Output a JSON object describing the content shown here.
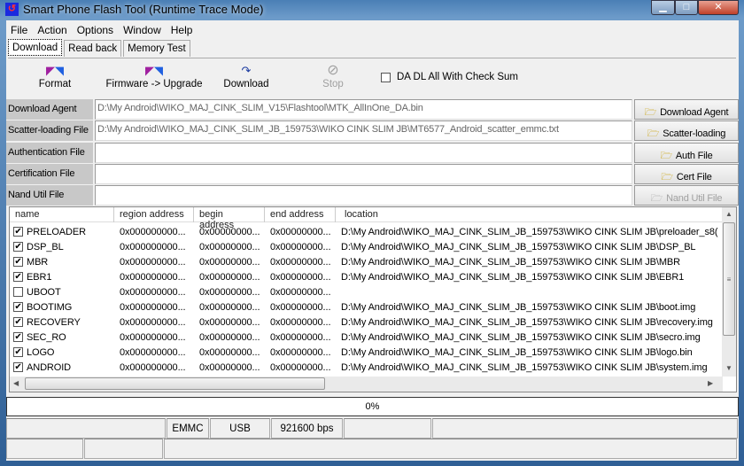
{
  "window": {
    "title": "Smart Phone Flash Tool (Runtime Trace Mode)",
    "controls": [
      "minimize",
      "maximize",
      "close"
    ]
  },
  "menu": [
    "File",
    "Action",
    "Options",
    "Window",
    "Help"
  ],
  "tabs": [
    {
      "label": "Download",
      "active": true
    },
    {
      "label": "Read back"
    },
    {
      "label": "Memory Test"
    }
  ],
  "toolbar": {
    "format": "Format",
    "firmware_upgrade": "Firmware -> Upgrade",
    "download": "Download",
    "stop": "Stop",
    "checksum_label": "DA DL All With Check Sum",
    "checksum_checked": false
  },
  "files": [
    {
      "label": "Download Agent",
      "value": "D:\\My Android\\WIKO_MAJ_CINK_SLIM_V15\\Flashtool\\MTK_AllInOne_DA.bin",
      "button": "Download Agent",
      "enabled": true
    },
    {
      "label": "Scatter-loading File",
      "value": "D:\\My Android\\WIKO_MAJ_CINK_SLIM_JB_159753\\WIKO CINK SLIM JB\\MT6577_Android_scatter_emmc.txt",
      "button": "Scatter-loading",
      "enabled": true
    },
    {
      "label": "Authentication File",
      "value": "",
      "button": "Auth File",
      "enabled": true
    },
    {
      "label": "Certification File",
      "value": "",
      "button": "Cert File",
      "enabled": true
    },
    {
      "label": "Nand Util File",
      "value": "",
      "button": "Nand Util File",
      "enabled": false
    }
  ],
  "table": {
    "columns": [
      "name",
      "region address",
      "begin address",
      "end address",
      "location"
    ],
    "rows": [
      {
        "checked": true,
        "name": "PRELOADER",
        "region": "0x000000000...",
        "begin": "0x00000000...",
        "end": "0x00000000...",
        "location": "D:\\My Android\\WIKO_MAJ_CINK_SLIM_JB_159753\\WIKO CINK SLIM JB\\preloader_s8("
      },
      {
        "checked": true,
        "name": "DSP_BL",
        "region": "0x000000000...",
        "begin": "0x00000000...",
        "end": "0x00000000...",
        "location": "D:\\My Android\\WIKO_MAJ_CINK_SLIM_JB_159753\\WIKO CINK SLIM JB\\DSP_BL"
      },
      {
        "checked": true,
        "name": "MBR",
        "region": "0x000000000...",
        "begin": "0x00000000...",
        "end": "0x00000000...",
        "location": "D:\\My Android\\WIKO_MAJ_CINK_SLIM_JB_159753\\WIKO CINK SLIM JB\\MBR"
      },
      {
        "checked": true,
        "name": "EBR1",
        "region": "0x000000000...",
        "begin": "0x00000000...",
        "end": "0x00000000...",
        "location": "D:\\My Android\\WIKO_MAJ_CINK_SLIM_JB_159753\\WIKO CINK SLIM JB\\EBR1"
      },
      {
        "checked": false,
        "name": "UBOOT",
        "region": "0x000000000...",
        "begin": "0x00000000...",
        "end": "0x00000000...",
        "location": ""
      },
      {
        "checked": true,
        "name": "BOOTIMG",
        "region": "0x000000000...",
        "begin": "0x00000000...",
        "end": "0x00000000...",
        "location": "D:\\My Android\\WIKO_MAJ_CINK_SLIM_JB_159753\\WIKO CINK SLIM JB\\boot.img"
      },
      {
        "checked": true,
        "name": "RECOVERY",
        "region": "0x000000000...",
        "begin": "0x00000000...",
        "end": "0x00000000...",
        "location": "D:\\My Android\\WIKO_MAJ_CINK_SLIM_JB_159753\\WIKO CINK SLIM JB\\recovery.img"
      },
      {
        "checked": true,
        "name": "SEC_RO",
        "region": "0x000000000...",
        "begin": "0x00000000...",
        "end": "0x00000000...",
        "location": "D:\\My Android\\WIKO_MAJ_CINK_SLIM_JB_159753\\WIKO CINK SLIM JB\\secro.img"
      },
      {
        "checked": true,
        "name": "LOGO",
        "region": "0x000000000...",
        "begin": "0x00000000...",
        "end": "0x00000000...",
        "location": "D:\\My Android\\WIKO_MAJ_CINK_SLIM_JB_159753\\WIKO CINK SLIM JB\\logo.bin"
      },
      {
        "checked": true,
        "name": "ANDROID",
        "region": "0x000000000...",
        "begin": "0x00000000...",
        "end": "0x00000000...",
        "location": "D:\\My Android\\WIKO_MAJ_CINK_SLIM_JB_159753\\WIKO CINK SLIM JB\\system.img"
      }
    ]
  },
  "progress": {
    "percent": 0,
    "label": "0%"
  },
  "status": {
    "storage": "EMMC",
    "interface": "USB",
    "baud": "921600 bps"
  }
}
